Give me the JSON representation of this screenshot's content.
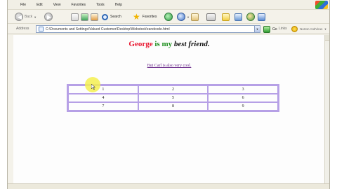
{
  "menu": [
    "File",
    "Edit",
    "View",
    "Favorites",
    "Tools",
    "Help"
  ],
  "toolbar": {
    "back_label": "Back",
    "search_label": "Search",
    "favorites_label": "Favorites"
  },
  "address": {
    "label": "Address",
    "url": "C:\\Documents and Settings\\Valued Customer\\Desktop\\Webstock\\randcode.html",
    "go_label": "Go",
    "links_label": "Links",
    "norton_label": "Norton AntiVirus"
  },
  "page": {
    "heading_name": "George",
    "heading_verb": "is my",
    "heading_rest": "best friend.",
    "link_text": "But Carl is also very cool.",
    "table_rows": [
      [
        "1",
        "2",
        "3"
      ],
      [
        "4",
        "5",
        "6"
      ],
      [
        "7",
        "8",
        "9"
      ]
    ]
  },
  "colors": {
    "name_red": "#e8162f",
    "verb_green": "#1f8f1f",
    "table_border": "#b6a0e6",
    "link_purple": "#6a2a8a"
  }
}
